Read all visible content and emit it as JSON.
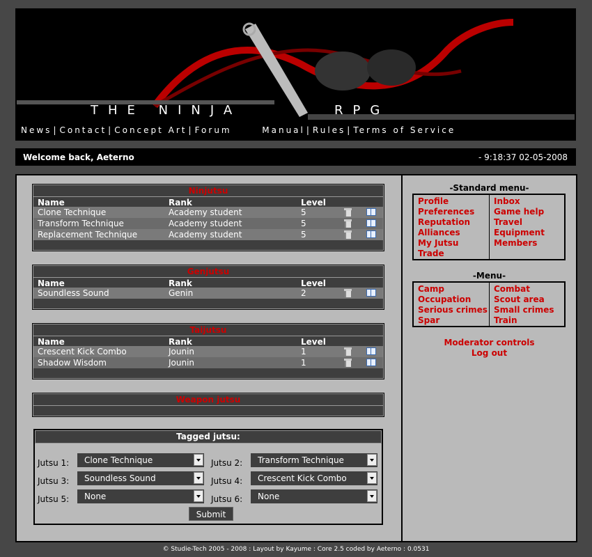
{
  "banner": {
    "title": "THE NINJA",
    "title_rpg": "RPG",
    "nav_left": [
      "News",
      "Contact",
      "Concept Art",
      "Forum"
    ],
    "nav_right": [
      "Manual",
      "Rules",
      "Terms of Service"
    ]
  },
  "welcome": {
    "greeting": "Welcome back, Aeterno",
    "clock": "- 9:18:37 02-05-2008"
  },
  "columns": {
    "name": "Name",
    "rank": "Rank",
    "level": "Level"
  },
  "sections": [
    {
      "title": "Ninjutsu",
      "rows": [
        {
          "name": "Clone Technique",
          "rank": "Academy student",
          "level": "5"
        },
        {
          "name": "Transform Technique",
          "rank": "Academy student",
          "level": "5"
        },
        {
          "name": "Replacement Technique",
          "rank": "Academy student",
          "level": "5"
        }
      ]
    },
    {
      "title": "Genjutsu",
      "rows": [
        {
          "name": "Soundless Sound",
          "rank": "Genin",
          "level": "2"
        }
      ]
    },
    {
      "title": "Taijutsu",
      "rows": [
        {
          "name": "Crescent Kick Combo",
          "rank": "Jounin",
          "level": "1"
        },
        {
          "name": "Shadow Wisdom",
          "rank": "Jounin",
          "level": "1"
        }
      ]
    },
    {
      "title": "Weapon jutsu",
      "rows": []
    }
  ],
  "tagged": {
    "title": "Tagged jutsu:",
    "slots": [
      {
        "label": "Jutsu 1:",
        "value": "Clone Technique"
      },
      {
        "label": "Jutsu 2:",
        "value": "Transform Technique"
      },
      {
        "label": "Jutsu 3:",
        "value": "Soundless Sound"
      },
      {
        "label": "Jutsu 4:",
        "value": "Crescent Kick Combo"
      },
      {
        "label": "Jutsu 5:",
        "value": "None"
      },
      {
        "label": "Jutsu 6:",
        "value": "None"
      }
    ],
    "submit": "Submit"
  },
  "standard_menu": {
    "title": "-Standard menu-",
    "left": [
      "Profile",
      "Preferences",
      "Reputation",
      "Alliances",
      "My Jutsu",
      "Trade"
    ],
    "right": [
      "Inbox",
      "Game help",
      "Travel",
      "Equipment",
      "Members"
    ]
  },
  "menu": {
    "title": "-Menu-",
    "left": [
      "Camp",
      "Occupation",
      "Serious crimes",
      "Spar"
    ],
    "right": [
      "Combat",
      "Scout area",
      "Small crimes",
      "Train"
    ]
  },
  "links": {
    "moderator": "Moderator controls",
    "logout": "Log out"
  },
  "footer": "© Studie-Tech 2005 - 2008 : Layout by Kayume : Core 2.5 coded by Aeterno : 0.0531",
  "colors": {
    "accent_red": "#cc0000",
    "panel_gray": "#bababa",
    "page_bg": "#474747"
  }
}
